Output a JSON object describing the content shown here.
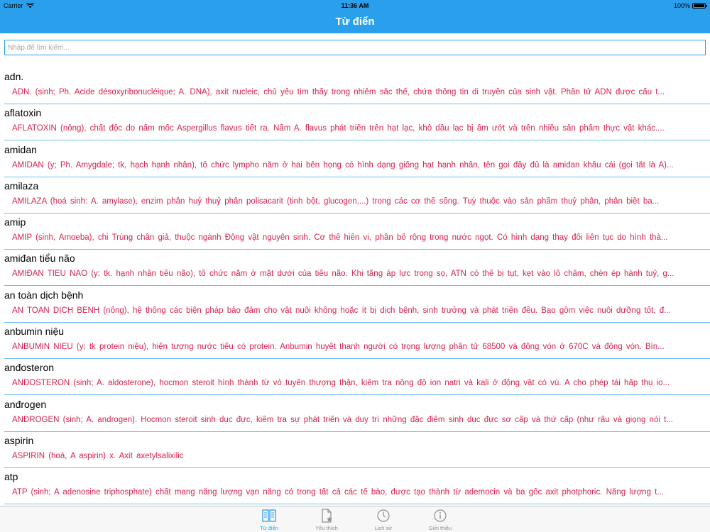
{
  "status_bar": {
    "carrier": "Carrier",
    "time": "11:36 AM",
    "battery": "100%"
  },
  "nav": {
    "title": "Từ điển"
  },
  "search": {
    "placeholder": "Nhập để tìm kiếm...",
    "value": ""
  },
  "entries": [
    {
      "term": "adn.",
      "definition": "ADN.  (sinh;  Ph.  Acide  désoxyribonucléique; A. DNA),  axit nucleic, chủ yếu   tìm thấy  trong  nhiễm sắc thể, chứa thông tin  di truyền của sinh vật.   Phân tử ADN  được cấu t..."
    },
    {
      "term": "aflatoxin",
      "definition": "AFLATOXIN  (nông), chất  độc do nấm mốc Aspergillus  flavus tiết ra. Nấm A. flavus    phát triển   trên hạt lạc, khô dầu lạc bị  ẩm ướt và trên nhiều sản phẩm     thực vật  khác...."
    },
    {
      "term": "amidan",
      "definition": "AMIDAN  (y; Ph.   Amygdale; tk, hạch hạnh nhân), tổ  chức lympho nằm ở hai bên   họng có   hình dạng giống hạt hạnh nhân, tên  gọi đầy đủ là amidan khẩu   cái (gọi   tắt là A)..."
    },
    {
      "term": "amilaza",
      "definition": "AMILAZA  (hoá  sinh: A.  amylase), enzim phân huỷ thuỷ  phân polisacarit (tinh   bột,    glucogen,...) trong các cơ thể sống. Tuỳ  thuộc vào sản phẩm thuỷ   phân,   phân biệt ba..."
    },
    {
      "term": "amip",
      "definition": "AMIP  (sinh,  Amoeba),  chi Trùng chân giả, thuộc  ngành Động vật nguyên sinh.   Cơ thể  hiển  vi, phân bố rộng trong nước  ngọt. Có hình dạng thay đổi   liên tục do   hình thà..."
    },
    {
      "term": "amiđan tiểu não",
      "definition": "AMIĐAN   TIỂU NÃO  (y:  tk. hạnh nhân tiểu não), tổ  chức nằm ở mặt dưới  của  tiểu não. Khi   tăng áp lực trong sọ, ATN có  thể bị tụt, kẹt vào lỗ  chẩm,  chèn ép  hành  tuỷ, g..."
    },
    {
      "term": "an toàn dịch bệnh",
      "definition": "AN   TOÀN DỊCH BỆNH  (nông), hệ thống các biện pháp  bảo đảm cho vật  nuôi  không hoặc ít bị   dịch bệnh, sinh trưởng và phát  triển đều. Bao  gồm việc  nuôi dưỡng  tốt,  đ..."
    },
    {
      "term": "anbumin niệu",
      "definition": "ANBUMIN   NIỆU  (y; tk  protein niệu), hiện tượng nước  tiểu có protein.   Anbumin huyết  thanh  người có trọng lượng phân tử  68500 và đông vón ở   670C  và đông vón.  Bìn..."
    },
    {
      "term": "anđosteron",
      "definition": "ANĐOSTERON  (sinh; A.  aldosterone), hocmon steroit  hình thành từ vỏ tuyến thượng    thận,  kiểm tra nồng độ ion natri và  kali ở động vật có vú. A cho phép    tái  hấp thụ io..."
    },
    {
      "term": "anđrogen",
      "definition": "ANĐROGEN  (sinh; A.  androgen). Hocmon steroit sinh  dục đực, kiểm tra sự phát   triển  và  duy trì những đặc điểm sinh dục  đực sơ cấp và thứ cấp (như râu   và   giọng nói t..."
    },
    {
      "term": "aspirin",
      "definition": "ASPIRIN  (hoá, A  aspirin) x. Axit axetylsalixilic"
    },
    {
      "term": "atp",
      "definition": "ATP  (sinh; A  adenosine  triphosphate) chất mang năng  lượng vạn năng có    trong tất cả  các tế  bào, được tạo thành từ  ademocin và ba gốc axit   photphoric. Năng   lượng t..."
    }
  ],
  "tabs": [
    {
      "label": "Từ điển",
      "icon": "book-icon",
      "active": true
    },
    {
      "label": "Yêu thích",
      "icon": "favorite-doc-icon",
      "active": false
    },
    {
      "label": "Lịch sử",
      "icon": "clock-icon",
      "active": false
    },
    {
      "label": "Giới thiệu",
      "icon": "info-icon",
      "active": false
    }
  ],
  "colors": {
    "accent": "#2aa0ec",
    "definition_text": "#d8234f",
    "separator": "#6fc0f0",
    "inactive_tab": "#8e8e93"
  }
}
